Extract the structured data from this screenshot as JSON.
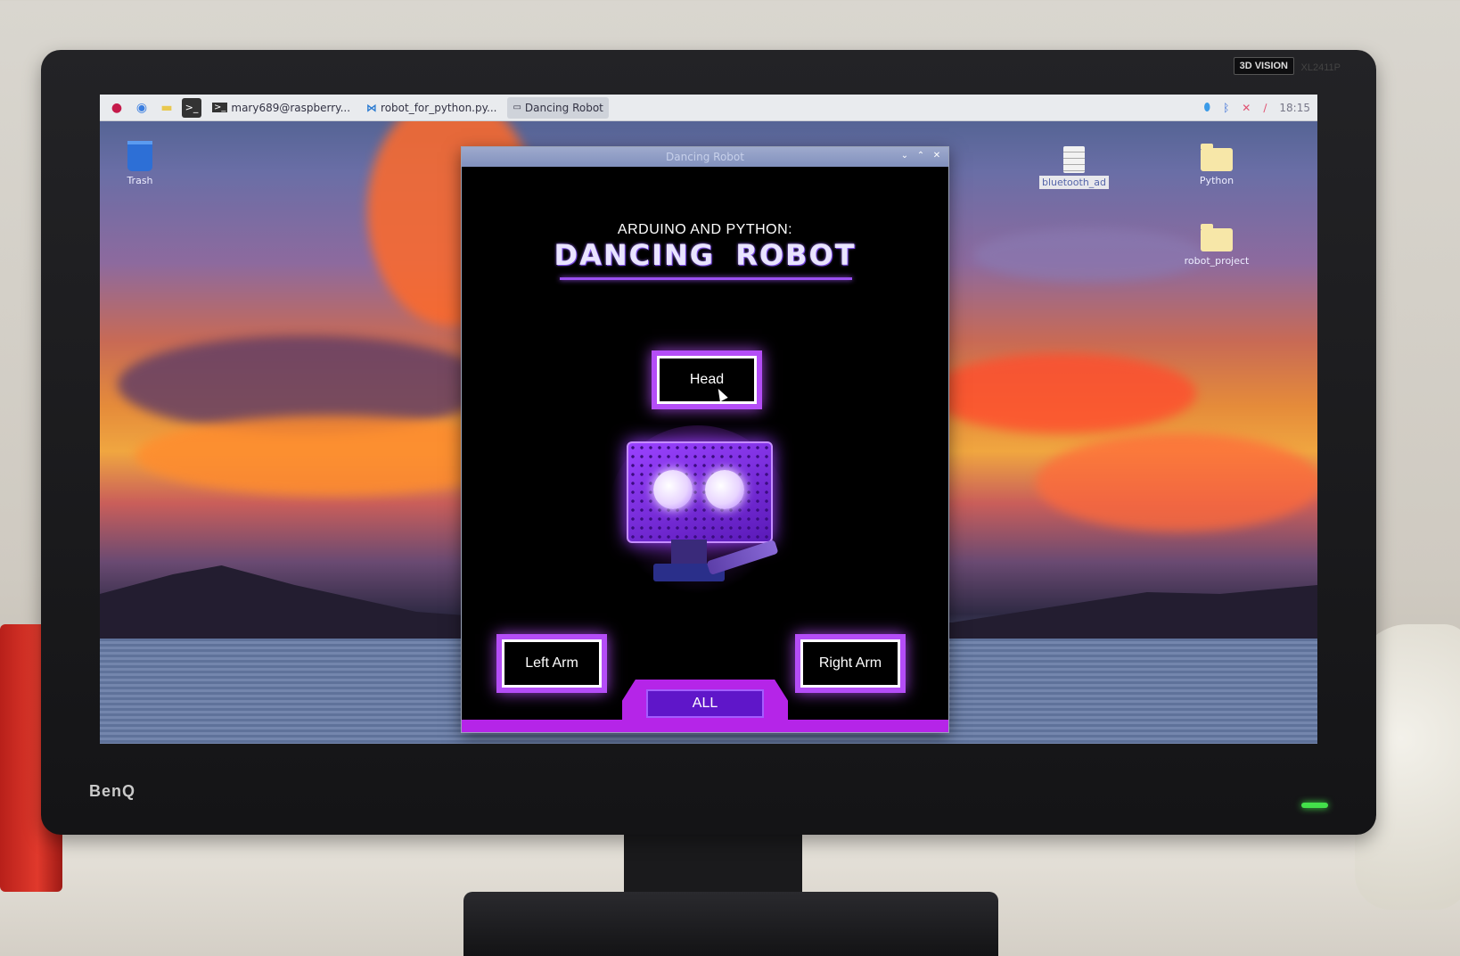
{
  "bezel": {
    "brand": "BenQ",
    "badge": "3D VISION",
    "model": "XL2411P"
  },
  "taskbar": {
    "items": [
      {
        "label": "",
        "icon": "raspberry-menu-icon"
      },
      {
        "label": "",
        "icon": "browser-icon"
      },
      {
        "label": "",
        "icon": "folder-icon"
      },
      {
        "label": "",
        "icon": "terminal-icon"
      },
      {
        "label": "mary689@raspberry...",
        "icon": "terminal-icon"
      },
      {
        "label": "robot_for_python.py...",
        "icon": "vscode-icon"
      },
      {
        "label": "Dancing Robot",
        "icon": "window-icon"
      }
    ],
    "clock": "18:15",
    "tray_icons": [
      "raspberry-badge-icon",
      "bluetooth-icon",
      "network-off-icon",
      "volume-icon"
    ]
  },
  "desktop": {
    "icons": [
      {
        "label": "Trash",
        "type": "trash"
      },
      {
        "label": "bluetooth_ad",
        "type": "file"
      },
      {
        "label": "Python",
        "type": "folder"
      },
      {
        "label": "robot_project",
        "type": "folder"
      }
    ]
  },
  "window": {
    "title": "Dancing Robot",
    "subtitle": "ARDUINO AND PYTHON:",
    "heading": "DANCING ROBOT",
    "buttons": {
      "head": "Head",
      "left_arm": "Left Arm",
      "right_arm": "Right Arm",
      "all": "ALL"
    },
    "accent_color": "#b44df7"
  }
}
